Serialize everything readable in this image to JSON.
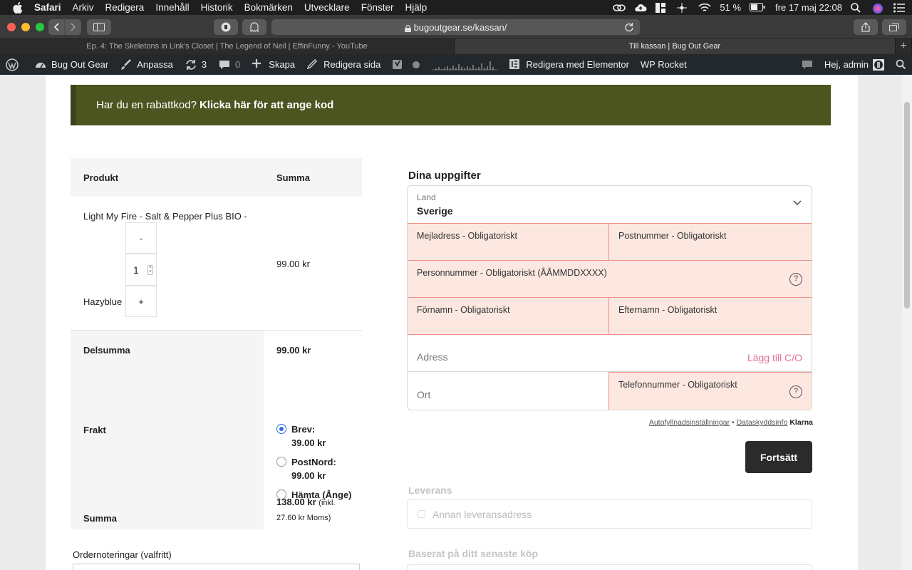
{
  "menubar": {
    "app": "Safari",
    "items": [
      "Arkiv",
      "Redigera",
      "Innehåll",
      "Historik",
      "Bokmärken",
      "Utvecklare",
      "Fönster",
      "Hjälp"
    ],
    "battery": "51 %",
    "clock": "fre 17 maj  22:08"
  },
  "browser": {
    "url": "bugoutgear.se/kassan/",
    "tabs": [
      {
        "title": "Ep. 4: The Skeletons in Link's Closet | The Legend of Neil | EffinFunny - YouTube"
      },
      {
        "title": "Till kassan | Bug Out Gear"
      }
    ],
    "new_tab": "+"
  },
  "wpbar": {
    "site": "Bug Out Gear",
    "customize": "Anpassa",
    "updates": "3",
    "comments": "0",
    "new": "Skapa",
    "edit": "Redigera sida",
    "elementor": "Redigera med Elementor",
    "rocket": "WP Rocket",
    "greeting": "Hej, admin"
  },
  "coupon": {
    "text": "Har du en rabattkod?",
    "link": "Klicka här för att ange kod"
  },
  "order": {
    "col_product": "Produkt",
    "col_total": "Summa",
    "product_name": "Light My Fire - Salt & Pepper Plus BIO -",
    "variant": "Hazyblue",
    "qty_minus": "-",
    "qty": "1",
    "qty_plus": "+",
    "price": "99.00 kr",
    "subtotal_label": "Delsumma",
    "subtotal": "99.00 kr",
    "shipping_label": "Frakt",
    "shipping_options": [
      {
        "name": "Brev:",
        "price": "39.00 kr",
        "selected": true
      },
      {
        "name": "PostNord:",
        "price": "99.00 kr",
        "selected": false
      },
      {
        "name": "Hämta (Ånge)",
        "price": "",
        "selected": false
      }
    ],
    "total_label": "Summa",
    "total": "138.00 kr",
    "total_tax_1": "(inkl.",
    "total_tax_2": "27.60 kr Moms)"
  },
  "notes": {
    "label": "Ordernoteringar (valfritt)"
  },
  "klarna": {
    "title": "Dina uppgifter",
    "land_label": "Land",
    "land_value": "Sverige",
    "email": "Mejladress - Obligatoriskt",
    "postcode": "Postnummer - Obligatoriskt",
    "ssn": "Personnummer - Obligatoriskt (ÅÅMMDDXXXX)",
    "firstname": "Förnamn - Obligatoriskt",
    "lastname": "Efternamn - Obligatoriskt",
    "address": "Adress",
    "co_link": "Lägg till C/O",
    "city": "Ort",
    "phone": "Telefonnummer - Obligatoriskt",
    "help": "?",
    "footer_autofill": "Autofyllnadsinställningar",
    "footer_sep": "•",
    "footer_privacy": "Dataskyddsinfo",
    "footer_brand": "Klarna",
    "continue": "Fortsätt",
    "delivery_title": "Leverans",
    "other_address": "Annan leveransadress",
    "previous_title": "Baserat på ditt senaste köp"
  },
  "colors": {
    "coupon_bg": "#4c5420",
    "error_bg": "#fde8e1",
    "error_border": "#f0908a",
    "co_link": "#e46f9d",
    "radio_selected": "#2f6fe6",
    "button": "#2b2b2b"
  }
}
